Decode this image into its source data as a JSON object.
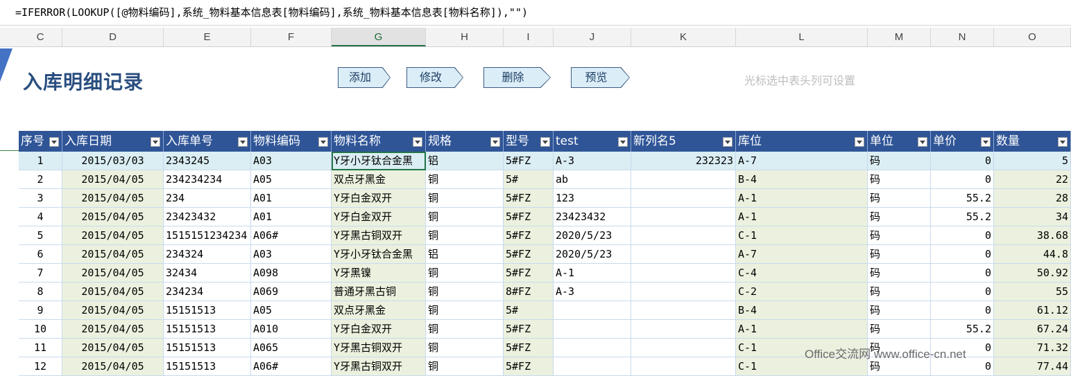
{
  "formula": "=IFERROR(LOOKUP([@物料编码],系统_物料基本信息表[物料编码],系统_物料基本信息表[物料名称]),\"\")",
  "columns": [
    "C",
    "D",
    "E",
    "F",
    "G",
    "H",
    "I",
    "J",
    "K",
    "L",
    "M",
    "N",
    "O"
  ],
  "title": "入库明细记录",
  "buttons": {
    "add": "添加",
    "edit": "修改",
    "delete": "删除",
    "preview": "预览"
  },
  "hint": "光标选中表头列可设置",
  "headers": [
    "序号",
    "入库日期",
    "入库单号",
    "物料编码",
    "物料名称",
    "规格",
    "型号",
    "test",
    "新列名5",
    "库位",
    "单位",
    "单价",
    "数量"
  ],
  "rows": [
    [
      "1",
      "2015/03/03",
      "2343245",
      "A03",
      "Y牙小牙钛合金黑",
      "铝",
      "5#FZ",
      "A-3",
      "232323",
      "A-7",
      "码",
      "0",
      "5"
    ],
    [
      "2",
      "2015/04/05",
      "234234234",
      "A05",
      "双点牙黑金",
      "铜",
      "5#",
      "ab",
      "",
      "B-4",
      "码",
      "0",
      "22"
    ],
    [
      "3",
      "2015/04/05",
      "234",
      "A01",
      "Y牙白金双开",
      "铜",
      "5#FZ",
      "123",
      "",
      "A-1",
      "码",
      "55.2",
      "28"
    ],
    [
      "4",
      "2015/04/05",
      "23423432",
      "A01",
      "Y牙白金双开",
      "铜",
      "5#FZ",
      "23423432",
      "",
      "A-1",
      "码",
      "55.2",
      "34"
    ],
    [
      "5",
      "2015/04/05",
      "1515151234234",
      "A06#",
      "Y牙黑古铜双开",
      "铜",
      "5#FZ",
      "2020/5/23",
      "",
      "C-1",
      "码",
      "0",
      "38.68"
    ],
    [
      "6",
      "2015/04/05",
      "234324",
      "A03",
      "Y牙小牙钛合金黑",
      "铝",
      "5#FZ",
      "2020/5/23",
      "",
      "A-7",
      "码",
      "0",
      "44.8"
    ],
    [
      "7",
      "2015/04/05",
      "32434",
      "A098",
      "Y牙黑镍",
      "铜",
      "5#FZ",
      "A-1",
      "",
      "C-4",
      "码",
      "0",
      "50.92"
    ],
    [
      "8",
      "2015/04/05",
      "234234",
      "A069",
      "普通牙黑古铜",
      "铜",
      "8#FZ",
      "A-3",
      "",
      "C-2",
      "码",
      "0",
      "55"
    ],
    [
      "9",
      "2015/04/05",
      "15151513",
      "A05",
      "双点牙黑金",
      "铜",
      "5#",
      "",
      "",
      "B-4",
      "码",
      "0",
      "61.12"
    ],
    [
      "10",
      "2015/04/05",
      "15151513",
      "A010",
      "Y牙白金双开",
      "铜",
      "5#FZ",
      "",
      "",
      "A-1",
      "码",
      "55.2",
      "67.24"
    ],
    [
      "11",
      "2015/04/05",
      "15151513",
      "A065",
      "Y牙黑古铜双开",
      "铜",
      "5#FZ",
      "",
      "",
      "C-1",
      "码",
      "0",
      "71.32"
    ],
    [
      "12",
      "2015/04/05",
      "15151513",
      "A06#",
      "Y牙黑古铜双开",
      "铜",
      "5#FZ",
      "",
      "",
      "C-1",
      "码",
      "0",
      "77.44"
    ]
  ],
  "watermark": "Office交流网 www.office-cn.net"
}
